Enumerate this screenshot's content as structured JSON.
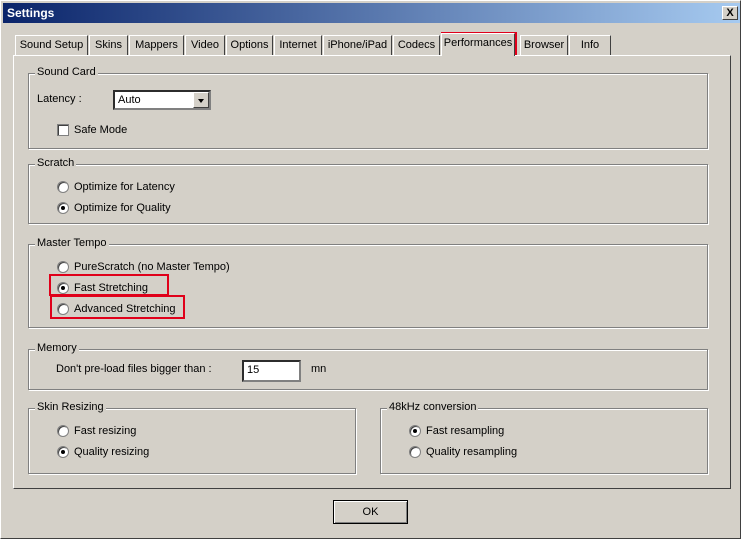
{
  "window": {
    "title": "Settings",
    "close_glyph": "X"
  },
  "tabs": [
    {
      "label": "Sound Setup"
    },
    {
      "label": "Skins"
    },
    {
      "label": "Mappers"
    },
    {
      "label": "Video"
    },
    {
      "label": "Options"
    },
    {
      "label": "Internet"
    },
    {
      "label": "iPhone/iPad"
    },
    {
      "label": "Codecs"
    },
    {
      "label": "Performances"
    },
    {
      "label": "Browser"
    },
    {
      "label": "Info"
    }
  ],
  "active_tab": "Performances",
  "sound_card": {
    "title": "Sound Card",
    "latency_label": "Latency :",
    "latency_value": "Auto",
    "safe_mode_label": "Safe Mode",
    "safe_mode_checked": false
  },
  "scratch": {
    "title": "Scratch",
    "options": [
      {
        "label": "Optimize for Latency",
        "selected": false
      },
      {
        "label": "Optimize for Quality",
        "selected": true
      }
    ]
  },
  "master_tempo": {
    "title": "Master Tempo",
    "options": [
      {
        "label": "PureScratch (no Master Tempo)",
        "selected": false
      },
      {
        "label": "Fast Stretching",
        "selected": true
      },
      {
        "label": "Advanced Stretching",
        "selected": false
      }
    ]
  },
  "memory": {
    "title": "Memory",
    "label": "Don't pre-load files bigger than :",
    "value": "15",
    "unit": "mn"
  },
  "skin_resizing": {
    "title": "Skin Resizing",
    "options": [
      {
        "label": "Fast resizing",
        "selected": false
      },
      {
        "label": "Quality resizing",
        "selected": true
      }
    ]
  },
  "conversion_48k": {
    "title": "48kHz conversion",
    "options": [
      {
        "label": "Fast resampling",
        "selected": true
      },
      {
        "label": "Quality resampling",
        "selected": false
      }
    ]
  },
  "ok_label": "OK",
  "highlight_color": "#e0001a"
}
